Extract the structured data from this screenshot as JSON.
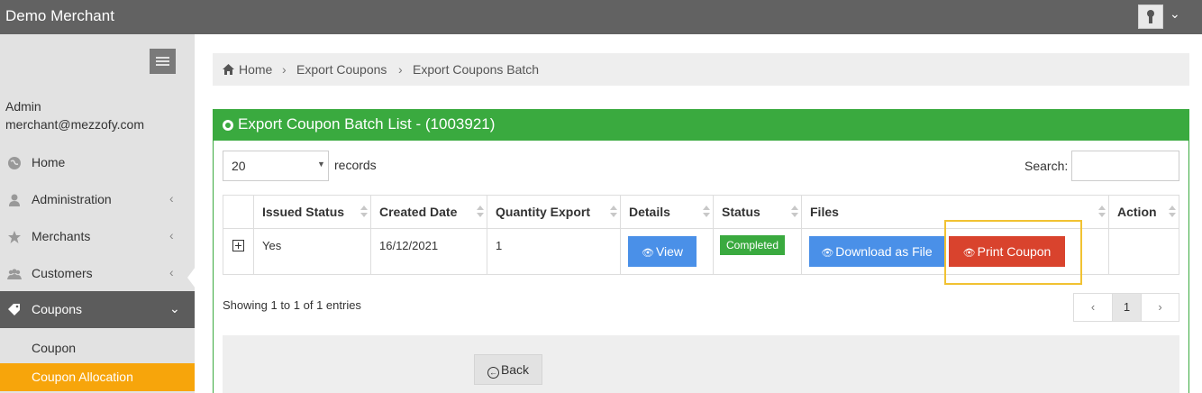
{
  "app": {
    "title": "Demo Merchant"
  },
  "user": {
    "name": "Admin",
    "email": "merchant@mezzofy.com"
  },
  "sidebar": {
    "items": [
      {
        "label": "Home",
        "icon": "globe-icon"
      },
      {
        "label": "Administration",
        "icon": "user-icon"
      },
      {
        "label": "Merchants",
        "icon": "star-icon"
      },
      {
        "label": "Customers",
        "icon": "users-icon"
      },
      {
        "label": "Coupons",
        "icon": "tag-icon"
      }
    ],
    "subitems": [
      {
        "label": "Coupon"
      },
      {
        "label": "Coupon Allocation"
      }
    ]
  },
  "breadcrumb": [
    "Home",
    "Export Coupons",
    "Export Coupons Batch"
  ],
  "panel": {
    "title": "Export Coupon Batch List - (1003921)"
  },
  "table_controls": {
    "length_value": "20",
    "records_label": "records",
    "search_label": "Search:"
  },
  "table": {
    "headers": [
      "Issued Status",
      "Created Date",
      "Quantity Export",
      "Details",
      "Status",
      "Files",
      "Action"
    ],
    "rows": [
      {
        "issued_status": "Yes",
        "created_date": "16/12/2021",
        "quantity_export": "1",
        "details_button": "View",
        "status": "Completed",
        "download_button": "Download as File",
        "print_button": "Print Coupon"
      }
    ]
  },
  "footer": {
    "info": "Showing 1 to 1 of 1 entries",
    "page": "1",
    "back_label": "Back"
  },
  "colors": {
    "topbar": "#626262",
    "panel_green": "#3aaa3f",
    "highlight": "#f7a50b",
    "btn_blue": "#4a90e8",
    "btn_red": "#d9432d"
  }
}
